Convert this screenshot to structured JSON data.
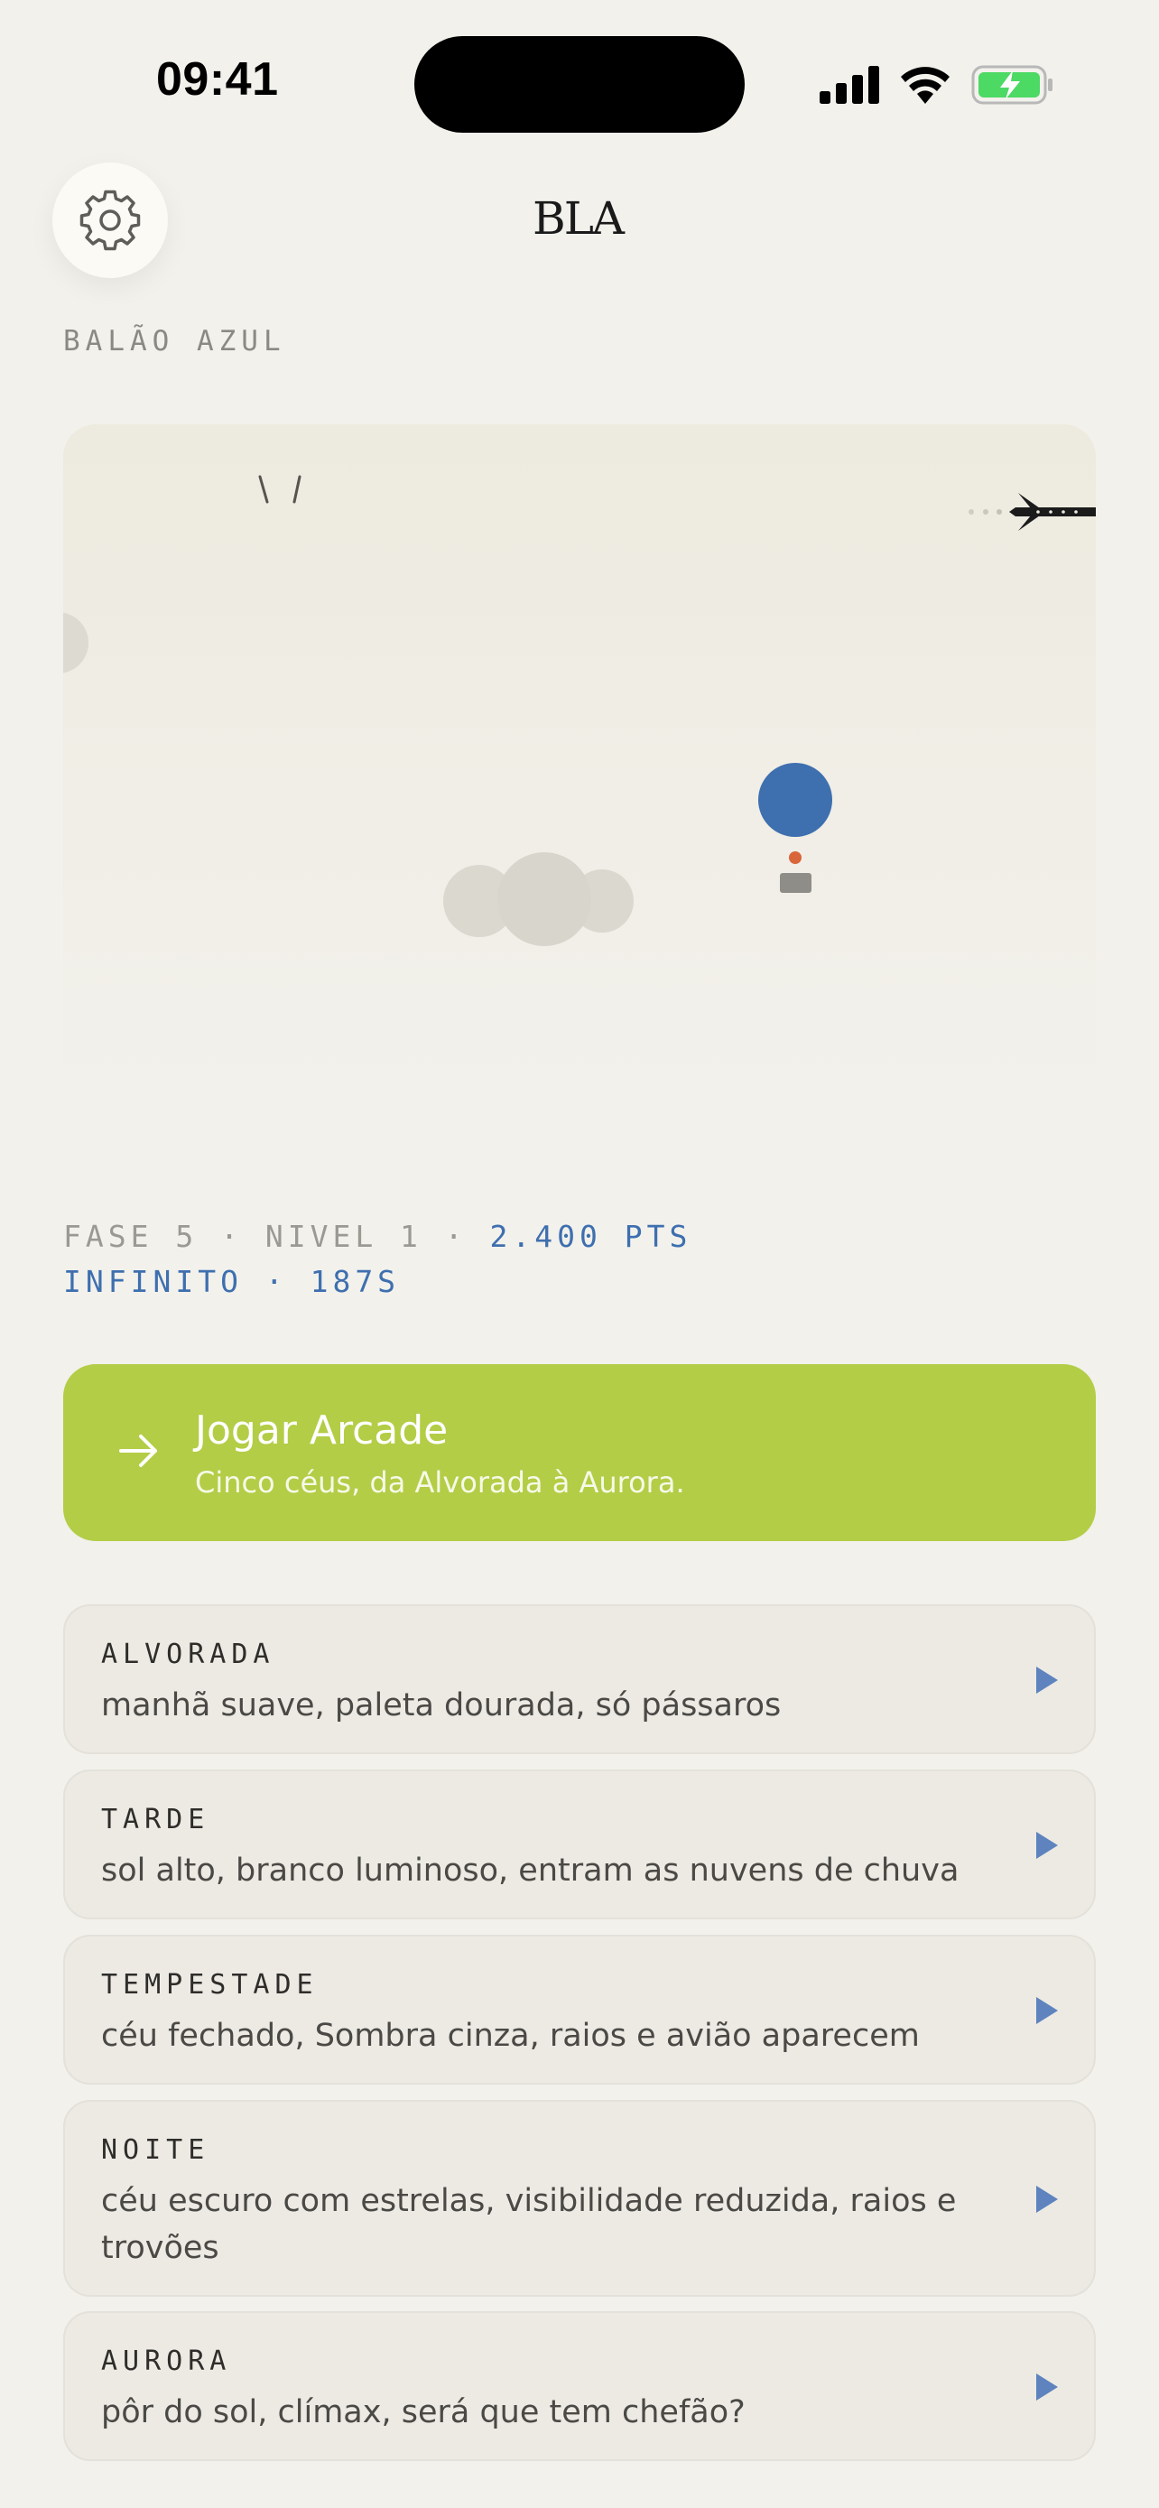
{
  "status": {
    "time": "09:41"
  },
  "header": {
    "logo": "BLA",
    "app_name": "BALÃO AZUL"
  },
  "stats": {
    "phase": "FASE 5",
    "level": "NIVEL 1",
    "points": "2.400 PTS",
    "mode": "INFINITO",
    "time": "187S",
    "separator": "·"
  },
  "arcade": {
    "title": "Jogar Arcade",
    "subtitle": "Cinco céus, da Alvorada à Aurora."
  },
  "levels": [
    {
      "name": "ALVORADA",
      "description": "manhã suave, paleta dourada, só pássaros"
    },
    {
      "name": "TARDE",
      "description": "sol alto, branco luminoso, entram as nuvens de chuva"
    },
    {
      "name": "TEMPESTADE",
      "description": "céu fechado, Sombra cinza, raios e avião aparecem"
    },
    {
      "name": "NOITE",
      "description": "céu escuro com estrelas, visibilidade reduzida, raios e trovões"
    },
    {
      "name": "AURORA",
      "description": "pôr do sol, clímax, será que tem chefão?"
    }
  ],
  "icons": {
    "settings": "gear-icon",
    "arcade": "arrow-right-icon",
    "level_play": "play-icon",
    "signal": "cellular-signal-icon",
    "wifi": "wifi-icon",
    "battery": "battery-charging-icon"
  },
  "colors": {
    "background": "#F2F1EC",
    "accent_green": "#B3CD46",
    "balloon_blue": "#3E6FAF",
    "stat_blue": "#3E6FAF",
    "card_bg": "#ECEAE3",
    "battery_green": "#4CD964"
  }
}
